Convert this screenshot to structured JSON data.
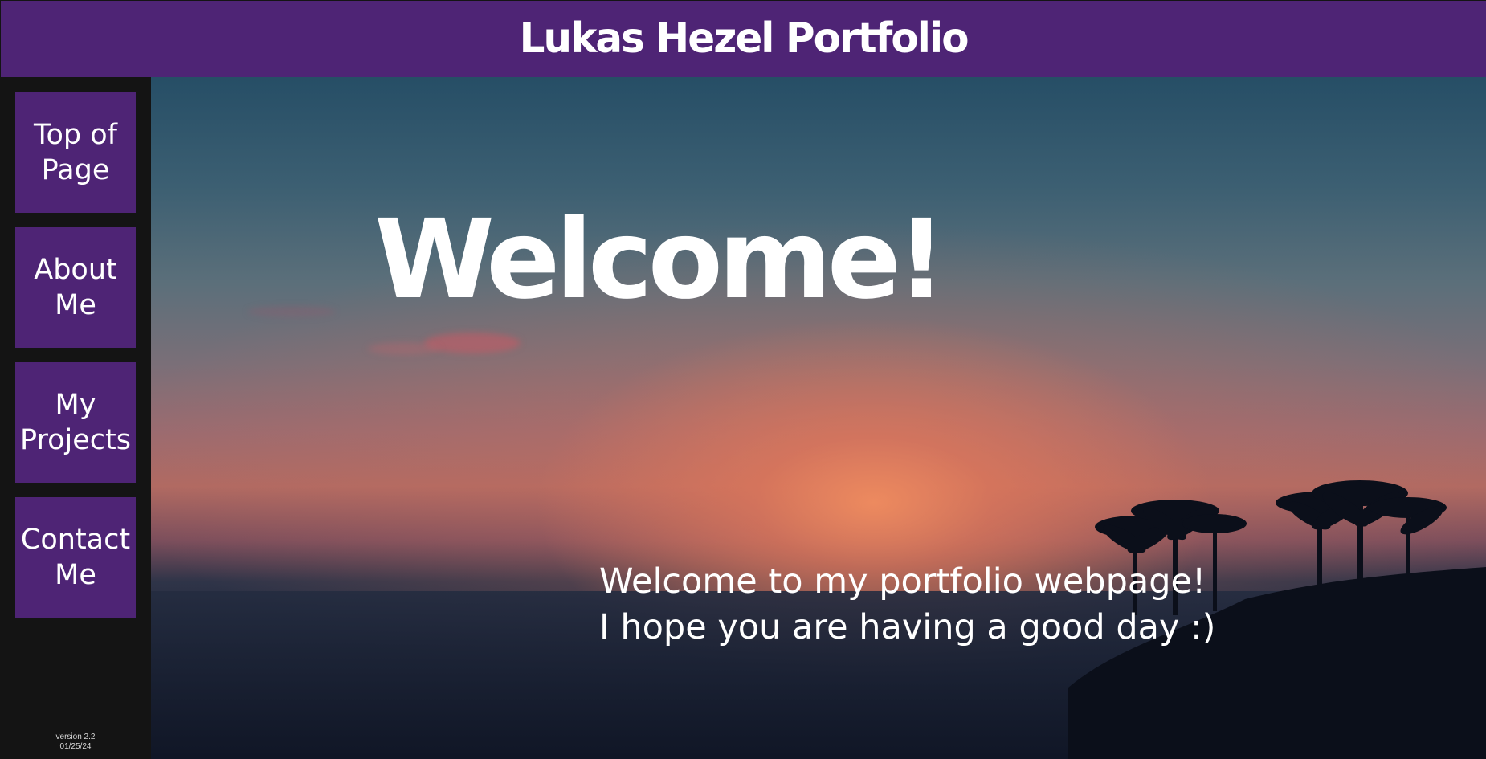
{
  "header": {
    "title": "Lukas Hezel Portfolio"
  },
  "sidebar": {
    "items": [
      {
        "label": "Top of\nPage"
      },
      {
        "label": "About\nMe"
      },
      {
        "label": "My\nProjects"
      },
      {
        "label": "Contact\nMe"
      }
    ],
    "version_line1": "version 2.2",
    "version_line2": "01/25/24"
  },
  "hero": {
    "title": "Welcome!",
    "line1": "Welcome to my portfolio webpage!",
    "line2": "I hope you are having a good day :)"
  },
  "colors": {
    "brand_purple": "#4e2475",
    "sidebar_bg": "#141414",
    "text": "#ffffff"
  }
}
